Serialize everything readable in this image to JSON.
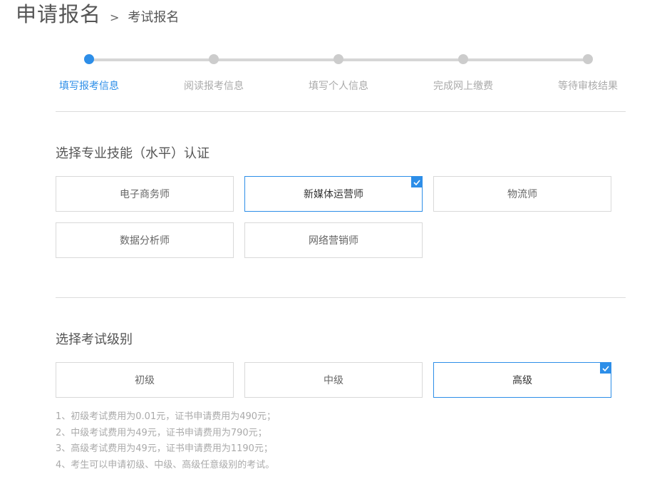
{
  "header": {
    "title": "申请报名",
    "separator": ">",
    "subtitle": "考试报名"
  },
  "steps": [
    {
      "label": "填写报考信息",
      "active": true
    },
    {
      "label": "阅读报考信息",
      "active": false
    },
    {
      "label": "填写个人信息",
      "active": false
    },
    {
      "label": "完成网上缴费",
      "active": false
    },
    {
      "label": "等待审核结果",
      "active": false
    }
  ],
  "skills": {
    "title": "选择专业技能（水平）认证",
    "options": [
      {
        "label": "电子商务师",
        "selected": false
      },
      {
        "label": "新媒体运营师",
        "selected": true
      },
      {
        "label": "物流师",
        "selected": false
      },
      {
        "label": "数据分析师",
        "selected": false
      },
      {
        "label": "网络营销师",
        "selected": false
      }
    ]
  },
  "levels": {
    "title": "选择考试级别",
    "options": [
      {
        "label": "初级",
        "selected": false
      },
      {
        "label": "中级",
        "selected": false
      },
      {
        "label": "高级",
        "selected": true
      }
    ]
  },
  "notes": [
    "1、初级考试费用为0.01元，证书申请费用为490元；",
    "2、中级考试费用为49元，证书申请费用为790元；",
    "3、高级考试费用为49元，证书申请费用为1190元；",
    "4、考生可以申请初级、中级、高级任意级别的考试。"
  ],
  "colors": {
    "accent": "#2d8ee8",
    "inactive_dot": "#cccccc",
    "border": "#d9d9d9"
  }
}
